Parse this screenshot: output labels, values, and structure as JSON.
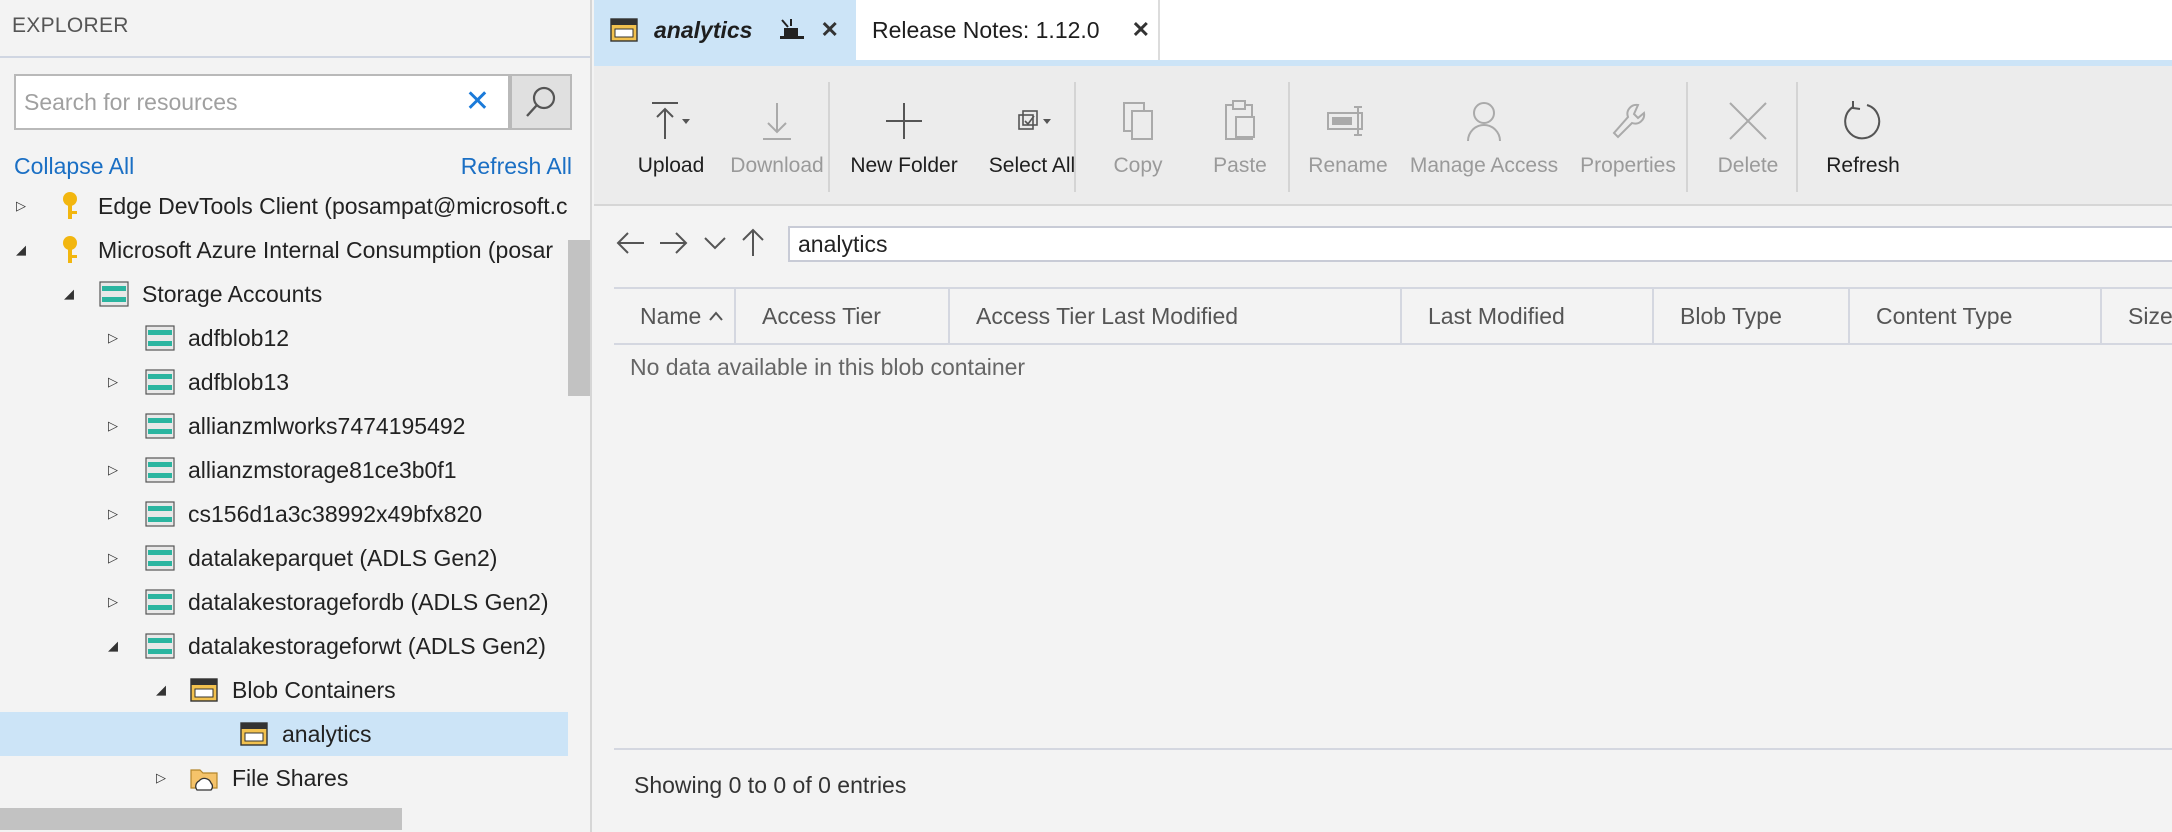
{
  "sidebar": {
    "header": "EXPLORER",
    "search_placeholder": "Search for resources",
    "collapse_all": "Collapse All",
    "refresh_all": "Refresh All",
    "tree": [
      {
        "label": "Edge DevTools Client (posampat@microsoft.c",
        "icon": "key-icon"
      },
      {
        "label": "Microsoft Azure Internal Consumption (posar",
        "icon": "key-icon"
      },
      {
        "label": "Storage Accounts",
        "icon": "storage-accounts-icon"
      },
      {
        "label": "adfblob12",
        "icon": "storage-account-icon"
      },
      {
        "label": "adfblob13",
        "icon": "storage-account-icon"
      },
      {
        "label": "allianzmlworks7474195492",
        "icon": "storage-account-icon"
      },
      {
        "label": "allianzmstorage81ce3b0f1",
        "icon": "storage-account-icon"
      },
      {
        "label": "cs156d1a3c38992x49bfx820",
        "icon": "storage-account-icon"
      },
      {
        "label": "datalakeparquet (ADLS Gen2)",
        "icon": "storage-account-icon"
      },
      {
        "label": "datalakestoragefordb (ADLS Gen2)",
        "icon": "storage-account-icon"
      },
      {
        "label": "datalakestorageforwt (ADLS Gen2)",
        "icon": "storage-account-icon"
      },
      {
        "label": "Blob Containers",
        "icon": "blob-containers-icon"
      },
      {
        "label": "analytics",
        "icon": "blob-container-icon"
      },
      {
        "label": "File Shares",
        "icon": "file-shares-icon"
      }
    ]
  },
  "tabs": [
    {
      "label": "analytics"
    },
    {
      "label": "Release Notes: 1.12.0"
    }
  ],
  "toolbar": {
    "upload": "Upload",
    "download": "Download",
    "new_folder": "New Folder",
    "select_all": "Select All",
    "copy": "Copy",
    "paste": "Paste",
    "rename": "Rename",
    "manage_access": "Manage Access",
    "properties": "Properties",
    "delete": "Delete",
    "refresh": "Refresh"
  },
  "path": "analytics",
  "table": {
    "columns": [
      "Name",
      "Access Tier",
      "Access Tier Last Modified",
      "Last Modified",
      "Blob Type",
      "Content Type",
      "Size"
    ],
    "empty_message": "No data available in this blob container"
  },
  "footer": "Showing 0 to 0 of 0 entries",
  "colors": {
    "accent": "#1a6fc4",
    "selection": "#cce4f7",
    "storage": "#2bb5a0",
    "key": "#f2b60f"
  }
}
